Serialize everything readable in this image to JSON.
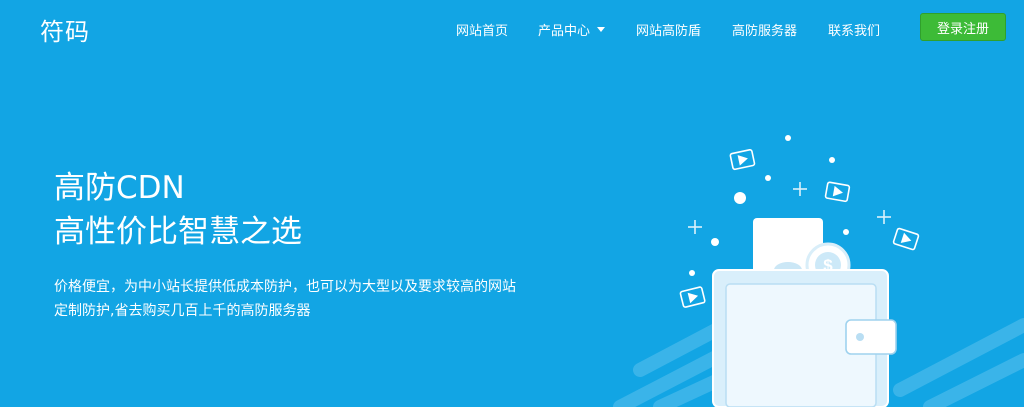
{
  "brand": {
    "logo": "符码"
  },
  "nav": {
    "items": [
      {
        "label": "网站首页"
      },
      {
        "label": "产品中心",
        "has_dropdown": true
      },
      {
        "label": "网站高防盾"
      },
      {
        "label": "高防服务器"
      },
      {
        "label": "联系我们"
      }
    ],
    "login_label": "登录注册"
  },
  "hero": {
    "title_line1": "高防CDN",
    "title_line2": "高性价比智慧之选",
    "description": "价格便宜，为中小站长提供低成本防护，也可以为大型以及要求较高的网站定制防护,省去购买几百上千的高防服务器"
  },
  "illustration": {
    "coin_symbol": "$"
  },
  "colors": {
    "background": "#12a5e4",
    "login_button": "#3dbb37",
    "text": "#ffffff"
  }
}
